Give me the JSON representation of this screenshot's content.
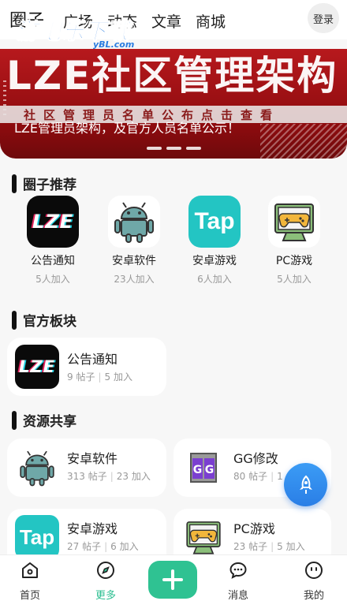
{
  "topbar": {
    "title": "圈子",
    "tabs": [
      "广场",
      "动态",
      "文章",
      "商城"
    ],
    "login_label": "登录",
    "watermark": "游吧乐下载",
    "watermark_sub": "yBL.com"
  },
  "banner": {
    "headline": "LZE社区管理架构",
    "strip_text": "社区管理员名单公布点击查看",
    "caption": "LZE管理员架构，及官方人员名单公示！",
    "page_indicator": {
      "total": 3,
      "active": 1
    }
  },
  "recommend": {
    "title": "圈子推荐",
    "items": [
      {
        "name": "公告通知",
        "count": "5人加入",
        "icon": "lze-logo-icon"
      },
      {
        "name": "安卓软件",
        "count": "23人加入",
        "icon": "android-robot-icon"
      },
      {
        "name": "安卓游戏",
        "count": "6人加入",
        "icon": "tap-logo-icon"
      },
      {
        "name": "PC游戏",
        "count": "5人加入",
        "icon": "gamepad-monitor-icon"
      }
    ]
  },
  "official": {
    "title": "官方板块",
    "cards": [
      {
        "title": "公告通知",
        "posts": "9 帖子",
        "joins": "5 加入",
        "icon": "lze-logo-icon"
      }
    ]
  },
  "resources": {
    "title": "资源共享",
    "cards": [
      {
        "title": "安卓软件",
        "posts": "313 帖子",
        "joins": "23 加入",
        "icon": "android-robot-icon"
      },
      {
        "title": "GG修改",
        "posts": "80 帖子",
        "joins": "1",
        "icon": "gg-logo-icon"
      },
      {
        "title": "安卓游戏",
        "posts": "27 帖子",
        "joins": "6 加入",
        "icon": "tap-logo-icon"
      },
      {
        "title": "PC游戏",
        "posts": "23 帖子",
        "joins": "5 加入",
        "icon": "gamepad-monitor-icon"
      }
    ]
  },
  "bottom_nav": {
    "items": [
      {
        "label": "首页",
        "icon": "home-icon"
      },
      {
        "label": "更多",
        "icon": "compass-icon",
        "active": true
      },
      {
        "label": "",
        "icon": "plus-icon"
      },
      {
        "label": "消息",
        "icon": "chat-icon"
      },
      {
        "label": "我的",
        "icon": "profile-face-icon"
      }
    ]
  },
  "colors": {
    "accent_green": "#2fc292",
    "fab_blue": "#2a7ee6",
    "tap_teal": "#23c5c3",
    "banner_red": "#b7191d"
  }
}
